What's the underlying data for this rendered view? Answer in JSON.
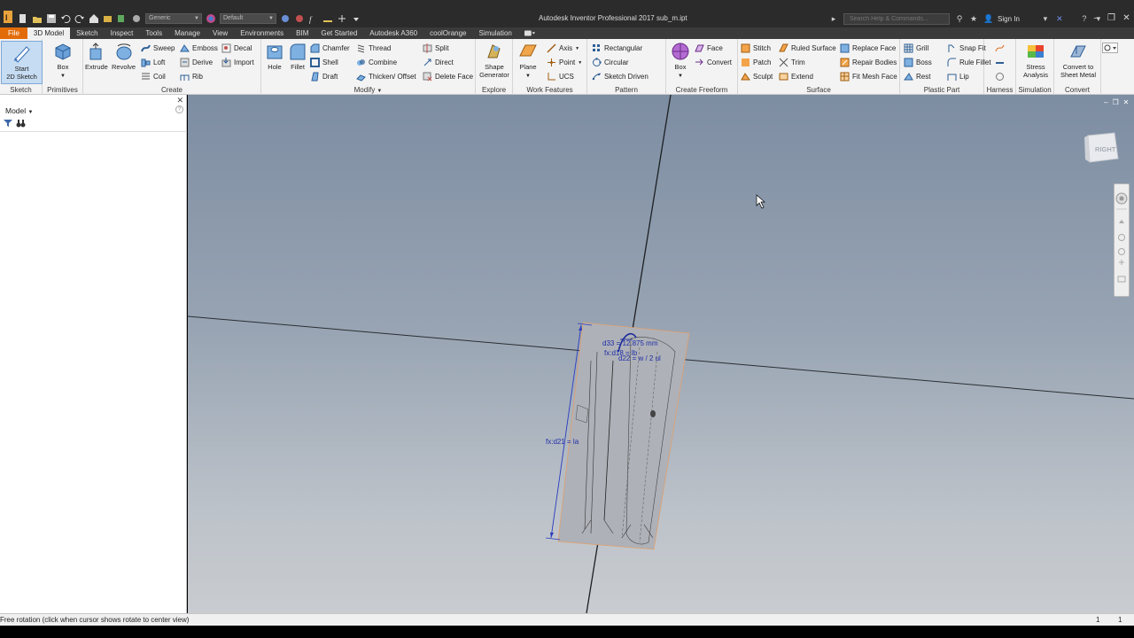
{
  "window": {
    "title": "Autodesk Inventor Professional 2017    sub_m.ipt",
    "help_search_placeholder": "Search Help & Commands...",
    "sign_in": "Sign In"
  },
  "qat": {
    "material": "Generic",
    "appearance": "Default"
  },
  "tabs": [
    "File",
    "3D Model",
    "Sketch",
    "Inspect",
    "Tools",
    "Manage",
    "View",
    "Environments",
    "BIM",
    "Get Started",
    "Autodesk A360",
    "coolOrange",
    "Simulation"
  ],
  "active_tab": "3D Model",
  "ribbon": {
    "sketch": {
      "label": "Sketch",
      "start": "Start\n2D Sketch"
    },
    "primitives": {
      "label": "Primitives",
      "box": "Box"
    },
    "create": {
      "label": "Create",
      "extrude": "Extrude",
      "revolve": "Revolve",
      "sweep": "Sweep",
      "loft": "Loft",
      "coil": "Coil",
      "emboss": "Emboss",
      "derive": "Derive",
      "rib": "Rib",
      "decal": "Decal",
      "import": "Import"
    },
    "modify": {
      "label": "Modify",
      "hole": "Hole",
      "fillet": "Fillet",
      "chamfer": "Chamfer",
      "shell": "Shell",
      "draft": "Draft",
      "thread": "Thread",
      "combine": "Combine",
      "thicken": "Thicken/ Offset",
      "split": "Split",
      "direct": "Direct",
      "delete_face": "Delete Face"
    },
    "explore": {
      "label": "Explore",
      "shape_generator": "Shape\nGenerator"
    },
    "work_features": {
      "label": "Work Features",
      "plane": "Plane",
      "axis": "Axis",
      "point": "Point",
      "ucs": "UCS"
    },
    "pattern": {
      "label": "Pattern",
      "rectangular": "Rectangular",
      "circular": "Circular",
      "sketch_driven": "Sketch Driven"
    },
    "create_freeform": {
      "label": "Create Freeform",
      "box": "Box",
      "face": "Face",
      "convert": "Convert"
    },
    "surface": {
      "label": "Surface",
      "stitch": "Stitch",
      "patch": "Patch",
      "sculpt": "Sculpt",
      "ruled_surface": "Ruled Surface",
      "trim": "Trim",
      "extend": "Extend",
      "replace_face": "Replace Face",
      "repair_bodies": "Repair Bodies",
      "fit_mesh_face": "Fit Mesh Face"
    },
    "plastic_part": {
      "label": "Plastic Part",
      "grill": "Grill",
      "boss": "Boss",
      "rest": "Rest",
      "snap_fit": "Snap Fit",
      "rule_fillet": "Rule Fillet",
      "lip": "Lip"
    },
    "harness": {
      "label": "Harness"
    },
    "simulation": {
      "label": "Simulation",
      "stress_analysis": "Stress\nAnalysis"
    },
    "convert": {
      "label": "Convert",
      "sheet_metal": "Convert to\nSheet Metal"
    }
  },
  "browser": {
    "title": "Model"
  },
  "viewport": {
    "viewcube_face": "RIGHT",
    "dim_d33": "d33 = 12.875 mm",
    "dim_fx": "fx:d18 = lb",
    "dim_d22": "d22 = w / 2 ul",
    "dim_d21": "fx:d21 = la"
  },
  "status": {
    "message": "Free rotation (click when cursor shows rotate to center view)",
    "count1": "1",
    "count2": "1"
  },
  "colors": {
    "accent_file_tab": "#e36c0a",
    "dimension": "#1f2ea8"
  }
}
